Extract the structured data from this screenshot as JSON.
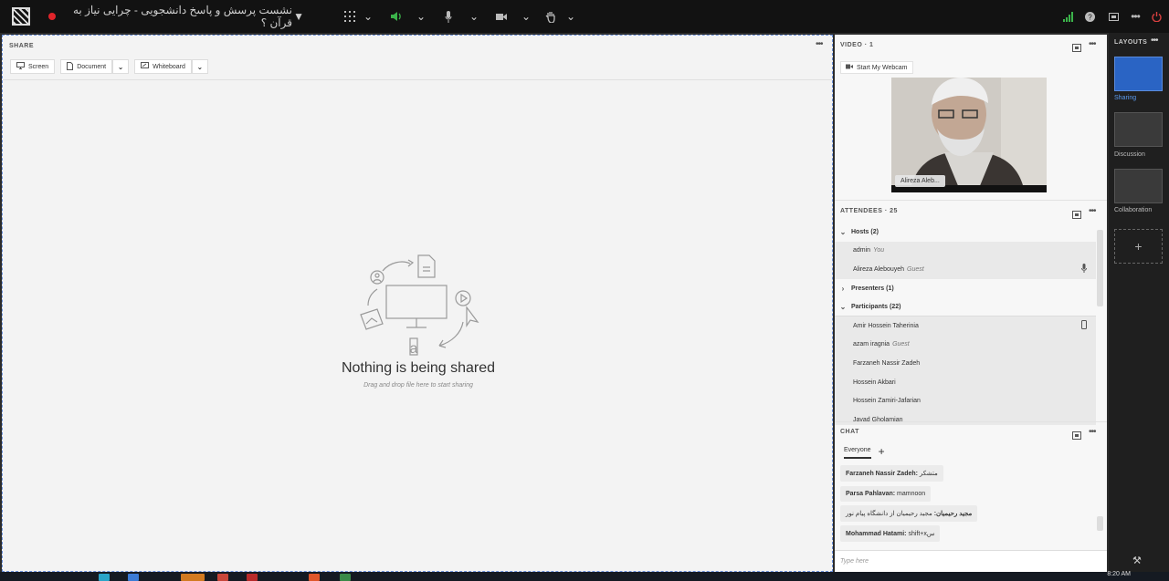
{
  "topbar": {
    "title": "نشست پرسش و پاسخ دانشجویی - چرایی نیاز به قرآن ؟"
  },
  "share": {
    "label": "SHARE",
    "tools": [
      {
        "label": "Screen"
      },
      {
        "label": "Document"
      },
      {
        "label": "Whiteboard"
      }
    ],
    "empty_title": "Nothing is being shared",
    "empty_sub": "Drag and drop file here to start sharing"
  },
  "video": {
    "label": "VIDEO",
    "count": "1",
    "webcam_button": "Start My Webcam",
    "name_tag": "Alireza Aleb..."
  },
  "attendees": {
    "label": "ATTENDEES",
    "count": "25",
    "groups": [
      {
        "label": "Hosts (2)",
        "expanded": true
      },
      {
        "label": "Presenters (1)",
        "expanded": false
      },
      {
        "label": "Participants (22)",
        "expanded": true
      }
    ],
    "hosts": [
      {
        "name": "admin",
        "tag": "You"
      },
      {
        "name": "Alireza Alebouyeh",
        "tag": "Guest",
        "icon": "microphone-icon"
      }
    ],
    "participants": [
      {
        "name": "Amir Hossein Taherinia",
        "tag": "",
        "icon": "mobile-device-icon"
      },
      {
        "name": "azam iragnia",
        "tag": "Guest"
      },
      {
        "name": "Farzaneh Nassir Zadeh",
        "tag": ""
      },
      {
        "name": "Hossein Akbari",
        "tag": ""
      },
      {
        "name": "Hossein Zamiri-Jafarian",
        "tag": ""
      },
      {
        "name": "Javad Gholamian",
        "tag": ""
      }
    ]
  },
  "chat": {
    "label": "CHAT",
    "tab": "Everyone",
    "messages": [
      {
        "sender": "Farzaneh Nassir Zadeh:",
        "text": "متشکر"
      },
      {
        "sender": "Parsa Pahlavan:",
        "text": "mamnoon"
      },
      {
        "sender": "مجید رحیمیان:",
        "text": "مجید رحیمیان از دانشگاه پیام نور"
      },
      {
        "sender": "Mohammad Hatami:",
        "text": "shift+xس"
      }
    ],
    "placeholder": "Type here"
  },
  "layouts": {
    "label": "LAYOUTS",
    "items": [
      {
        "label": "Sharing",
        "active": true
      },
      {
        "label": "Discussion",
        "active": false
      },
      {
        "label": "Collaboration",
        "active": false
      }
    ]
  },
  "taskbar": {
    "time": "8:20 AM"
  },
  "colors": {
    "accent": "#2a64c4",
    "record": "#e0242a",
    "speaker": "#3bb34a"
  }
}
